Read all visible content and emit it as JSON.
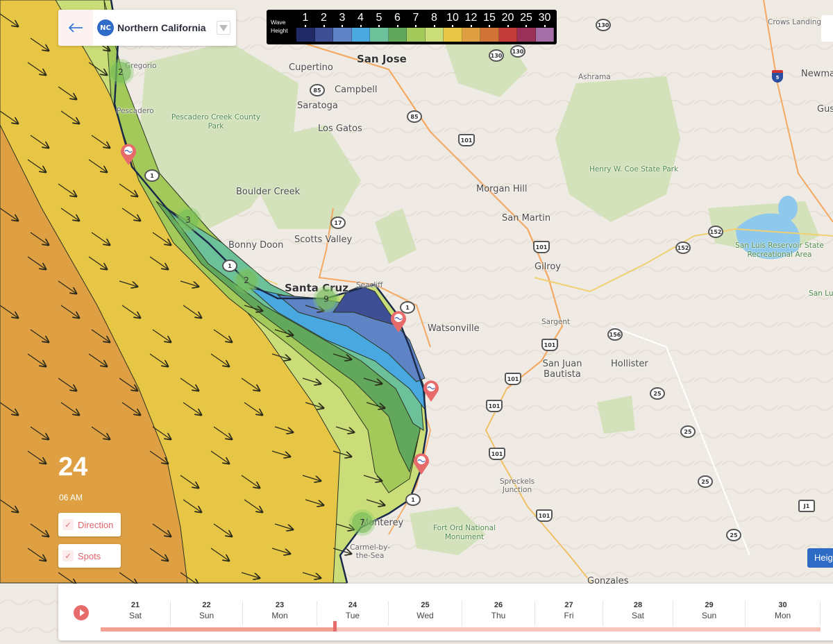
{
  "region": {
    "badge": "NC",
    "name": "Northern California",
    "back_icon": "arrow-left-icon",
    "dropdown_icon": "caret-down-icon"
  },
  "legend": {
    "title_line1": "Wave",
    "title_line2": "Height",
    "items": [
      {
        "label": "1",
        "color": "#1f2a66"
      },
      {
        "label": "2",
        "color": "#3f4f96"
      },
      {
        "label": "3",
        "color": "#5f84c6"
      },
      {
        "label": "4",
        "color": "#4aa8e0"
      },
      {
        "label": "5",
        "color": "#6cc09a"
      },
      {
        "label": "6",
        "color": "#62a85c"
      },
      {
        "label": "7",
        "color": "#a3c95a"
      },
      {
        "label": "8",
        "color": "#cadd78"
      },
      {
        "label": "10",
        "color": "#e8c645"
      },
      {
        "label": "12",
        "color": "#dea043"
      },
      {
        "label": "15",
        "color": "#cf7436"
      },
      {
        "label": "20",
        "color": "#c43c3a"
      },
      {
        "label": "25",
        "color": "#9a3158"
      },
      {
        "label": "30",
        "color": "#a46ea6"
      }
    ]
  },
  "time": {
    "day": "24",
    "hour": "06 AM"
  },
  "toggles": {
    "direction": {
      "label": "Direction",
      "checked": true
    },
    "spots": {
      "label": "Spots",
      "checked": true
    }
  },
  "height_button": {
    "label": "Heig"
  },
  "timeline": {
    "play_icon": "play-icon",
    "days": [
      {
        "num": "21",
        "weekday": "Sat"
      },
      {
        "num": "22",
        "weekday": "Sun"
      },
      {
        "num": "23",
        "weekday": "Mon"
      },
      {
        "num": "24",
        "weekday": "Tue"
      },
      {
        "num": "25",
        "weekday": "Wed"
      },
      {
        "num": "26",
        "weekday": "Thu"
      },
      {
        "num": "27",
        "weekday": "Fri"
      },
      {
        "num": "28",
        "weekday": "Sat"
      },
      {
        "num": "29",
        "weekday": "Sun"
      },
      {
        "num": "30",
        "weekday": "Mon"
      }
    ],
    "progress": 0.325
  },
  "map": {
    "places": [
      {
        "name": "San Jose",
        "kind": "big"
      },
      {
        "name": "Cupertino",
        "kind": "city"
      },
      {
        "name": "Campbell",
        "kind": "city"
      },
      {
        "name": "Saratoga",
        "kind": "city"
      },
      {
        "name": "Los Gatos",
        "kind": "city"
      },
      {
        "name": "Gregorio",
        "kind": "small"
      },
      {
        "name": "Pescadero",
        "kind": "small"
      },
      {
        "name": "Pescadero Creek County Park",
        "kind": "park"
      },
      {
        "name": "Boulder Creek",
        "kind": "city"
      },
      {
        "name": "Bonny Doon",
        "kind": "city"
      },
      {
        "name": "Scotts Valley",
        "kind": "city"
      },
      {
        "name": "Santa Cruz",
        "kind": "big"
      },
      {
        "name": "Seacliff",
        "kind": "small"
      },
      {
        "name": "Watsonville",
        "kind": "city"
      },
      {
        "name": "Morgan Hill",
        "kind": "city"
      },
      {
        "name": "San Martin",
        "kind": "city"
      },
      {
        "name": "Gilroy",
        "kind": "city"
      },
      {
        "name": "Sargent",
        "kind": "small"
      },
      {
        "name": "San Juan Bautista",
        "kind": "city"
      },
      {
        "name": "Hollister",
        "kind": "city"
      },
      {
        "name": "Henry W. Coe State Park",
        "kind": "park"
      },
      {
        "name": "San Luis Reservoir State Recreational Area",
        "kind": "park"
      },
      {
        "name": "San Lu Rec",
        "kind": "park"
      },
      {
        "name": "Ashrama",
        "kind": "small"
      },
      {
        "name": "Crows Landing",
        "kind": "small"
      },
      {
        "name": "Newma",
        "kind": "city"
      },
      {
        "name": "Gust",
        "kind": "city"
      },
      {
        "name": "Spreckels Junction",
        "kind": "small"
      },
      {
        "name": "Fort Ord National Monument",
        "kind": "park"
      },
      {
        "name": "Monterey",
        "kind": "city"
      },
      {
        "name": "Carmel-by-the-Sea",
        "kind": "small"
      },
      {
        "name": "Gonzales",
        "kind": "city"
      }
    ],
    "shields": [
      "130",
      "130",
      "130",
      "85",
      "85",
      "101",
      "101",
      "101",
      "101",
      "101",
      "101",
      "101",
      "17",
      "1",
      "1",
      "1",
      "1",
      "152",
      "152",
      "156",
      "25",
      "25",
      "25",
      "25",
      "J1",
      "5"
    ],
    "clusters": [
      "2",
      "3",
      "2",
      "9",
      "7"
    ],
    "spot_pins": 4
  }
}
